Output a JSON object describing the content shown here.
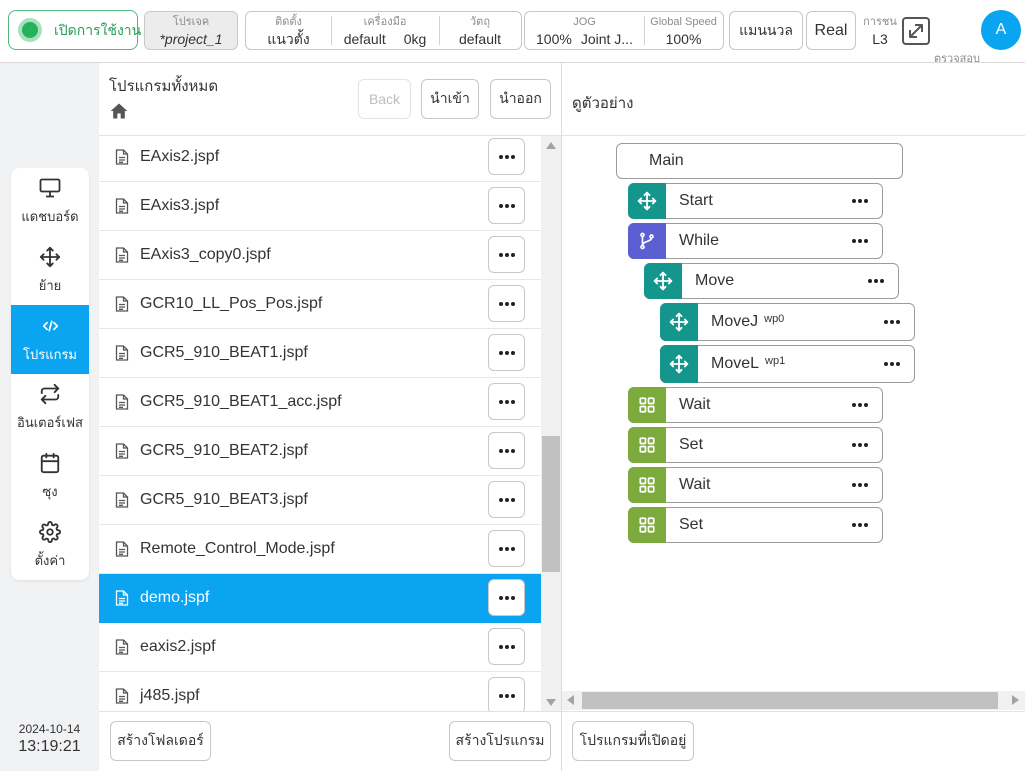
{
  "colors": {
    "accent": "#0aa4f0",
    "enable_green": "#24b25a"
  },
  "topbar": {
    "enable_label": "เปิดการใช้งาน",
    "project_title": "โปรเจค",
    "project_value": "*project_1",
    "install_title": "ติดตั้ง",
    "install_value": "แนวตั้ง",
    "tool_title": "เครื่องมือ",
    "tool_value": "default",
    "tool_weight": "0kg",
    "object_title": "วัตถุ",
    "object_value": "default",
    "jog_title": "JOG",
    "jog_value": "100%",
    "jog_mode": "Joint J...",
    "speed_title": "Global Speed",
    "speed_value": "100%",
    "manual_label": "แมนนวล",
    "real_label": "Real",
    "collision_title": "การชน",
    "collision_value": "L3",
    "expand_icon": "expand-icon",
    "check_title": "ตรวจสอบ",
    "check_value": "26c4",
    "avatar_letter": "A"
  },
  "sidebar": {
    "items": [
      {
        "label": "แดชบอร์ด",
        "icon": "monitor-icon",
        "active": false
      },
      {
        "label": "ย้าย",
        "icon": "move-icon",
        "active": false
      },
      {
        "label": "โปรแกรม",
        "icon": "code-icon",
        "active": true
      },
      {
        "label": "อินเตอร์เฟส",
        "icon": "repeat-icon",
        "active": false
      },
      {
        "label": "ซุง",
        "icon": "calendar-icon",
        "active": false
      },
      {
        "label": "ตั้งค่า",
        "icon": "gear-icon",
        "active": false
      }
    ],
    "date": "2024-10-14",
    "time": "13:19:21"
  },
  "files": {
    "title": "โปรแกรมทั้งหมด",
    "home_icon": "home-icon",
    "back_label": "Back",
    "import_label": "นำเข้า",
    "export_label": "นำออก",
    "items": [
      {
        "name": "EAxis2.jspf",
        "selected": false
      },
      {
        "name": "EAxis3.jspf",
        "selected": false
      },
      {
        "name": "EAxis3_copy0.jspf",
        "selected": false
      },
      {
        "name": "GCR10_LL_Pos_Pos.jspf",
        "selected": false
      },
      {
        "name": "GCR5_910_BEAT1.jspf",
        "selected": false
      },
      {
        "name": "GCR5_910_BEAT1_acc.jspf",
        "selected": false
      },
      {
        "name": "GCR5_910_BEAT2.jspf",
        "selected": false
      },
      {
        "name": "GCR5_910_BEAT3.jspf",
        "selected": false
      },
      {
        "name": "Remote_Control_Mode.jspf",
        "selected": false
      },
      {
        "name": "demo.jspf",
        "selected": true
      },
      {
        "name": "eaxis2.jspf",
        "selected": false
      },
      {
        "name": "j485.jspf",
        "selected": false
      }
    ],
    "new_folder_label": "สร้างโฟลเดอร์",
    "new_program_label": "สร้างโปรแกรม"
  },
  "preview": {
    "title": "ดูตัวอย่าง",
    "tree": {
      "label": "Main",
      "children": [
        {
          "label": "Start",
          "icon": "move-icon",
          "color": "#15968c"
        },
        {
          "label": "While",
          "icon": "branch-icon",
          "color": "#5b5fd2",
          "children": [
            {
              "label": "Move",
              "icon": "move-icon",
              "color": "#15968c",
              "children": [
                {
                  "label": "MoveJ",
                  "arg": "wp0",
                  "icon": "move-icon",
                  "color": "#15968c"
                },
                {
                  "label": "MoveL",
                  "arg": "wp1",
                  "icon": "move-icon",
                  "color": "#15968c"
                }
              ]
            }
          ]
        },
        {
          "label": "Wait",
          "icon": "grid-icon",
          "color": "#7caa3c"
        },
        {
          "label": "Set",
          "icon": "grid-icon",
          "color": "#7caa3c"
        },
        {
          "label": "Wait",
          "icon": "grid-icon",
          "color": "#7caa3c"
        },
        {
          "label": "Set",
          "icon": "grid-icon",
          "color": "#7caa3c"
        }
      ]
    },
    "open_programs_label": "โปรแกรมที่เปิดอยู่"
  }
}
